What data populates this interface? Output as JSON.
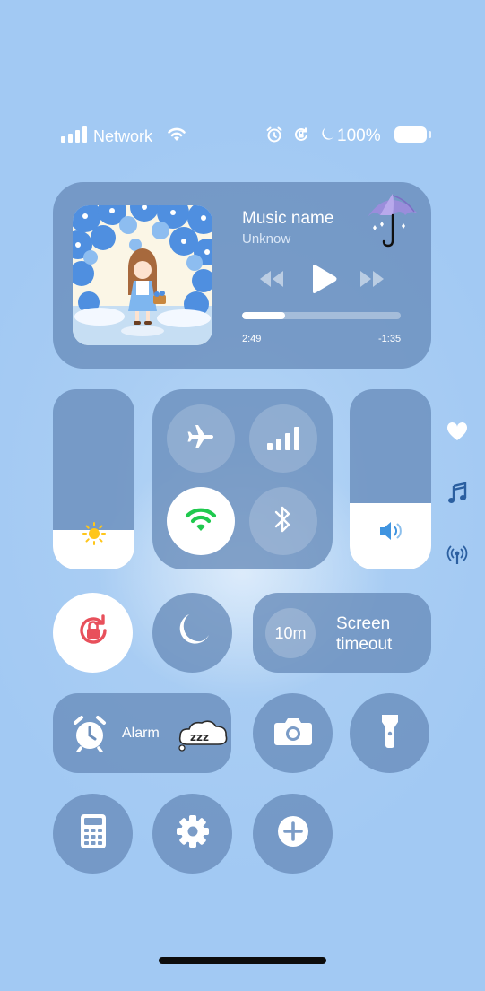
{
  "status_bar": {
    "network_label": "Network",
    "battery_text": "100%",
    "icons": [
      "signal-icon",
      "wifi-icon",
      "alarm-icon",
      "rotation-lock-icon",
      "moon-icon",
      "battery-icon"
    ]
  },
  "music": {
    "title": "Music name",
    "artist": "Unknow",
    "elapsed": "2:49",
    "remaining": "-1:35",
    "progress": 0.27
  },
  "brightness": {
    "level": 0.22
  },
  "volume": {
    "level": 0.37
  },
  "connectivity": {
    "buttons": [
      "airplane-icon",
      "cellular-icon",
      "wifi-icon",
      "bluetooth-icon"
    ],
    "wifi_active_color": "#1fc94e"
  },
  "side_icons": [
    "heart-icon",
    "music-note-icon",
    "broadcast-icon"
  ],
  "screen_timeout": {
    "value": "10m",
    "label_line1": "Screen",
    "label_line2": "timeout"
  },
  "alarm": {
    "label": "Alarm",
    "zzz": "zzz"
  },
  "colors": {
    "accent_red": "#e8505b",
    "sun_yellow": "#ffc61a",
    "volume_blue": "#3f94e0"
  }
}
